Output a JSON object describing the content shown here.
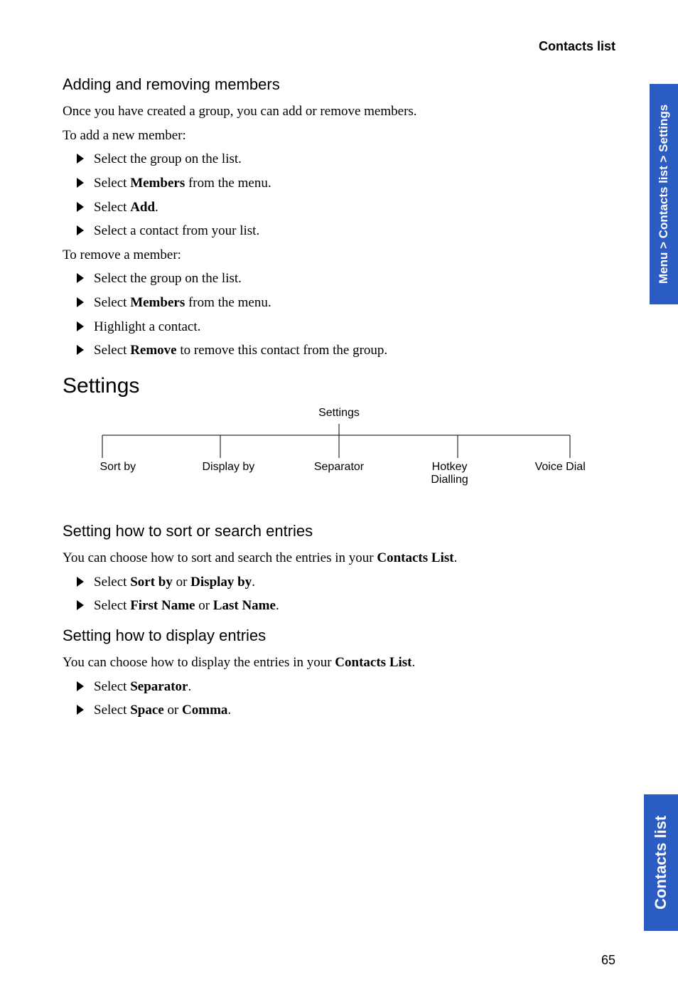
{
  "header": {
    "title": "Contacts list"
  },
  "sections": {
    "adding": {
      "heading": "Adding and removing members",
      "intro": "Once you have created a group, you can add or remove members.",
      "add_intro": "To add a new member:",
      "add_steps": {
        "s1": "Select the group on the list.",
        "s2_pre": "Select ",
        "s2_b": "Members",
        "s2_post": " from the menu.",
        "s3_pre": "Select ",
        "s3_b": "Add",
        "s3_post": ".",
        "s4": "Select a contact from your list."
      },
      "remove_intro": "To remove a member:",
      "remove_steps": {
        "s1": "Select the group on the list.",
        "s2_pre": "Select ",
        "s2_b": "Members",
        "s2_post": " from the menu.",
        "s3": "Highlight a contact.",
        "s4_pre": "Select ",
        "s4_b": "Remove",
        "s4_post": " to remove this contact from the group."
      }
    },
    "settings": {
      "heading": "Settings",
      "root": "Settings",
      "leaves": {
        "l1": "Sort by",
        "l2": "Display by",
        "l3": "Separator",
        "l4a": "Hotkey",
        "l4b": "Dialling",
        "l5": "Voice Dial"
      }
    },
    "sort": {
      "heading": "Setting how to sort or search entries",
      "intro_pre": "You can choose how to sort and search the entries in your ",
      "intro_b": "Contacts List",
      "intro_post": ".",
      "s1_pre": "Select ",
      "s1_b1": "Sort by",
      "s1_mid": " or ",
      "s1_b2": "Display by",
      "s1_post": ".",
      "s2_pre": "Select ",
      "s2_b1": "First Name",
      "s2_mid": " or ",
      "s2_b2": "Last Name",
      "s2_post": "."
    },
    "display": {
      "heading": "Setting how to display entries",
      "intro_pre": "You can choose how to display the entries in your ",
      "intro_b": "Contacts List",
      "intro_post": ".",
      "s1_pre": "Select ",
      "s1_b": "Separator",
      "s1_post": ".",
      "s2_pre": "Select ",
      "s2_b1": "Space",
      "s2_mid": " or ",
      "s2_b2": "Comma",
      "s2_post": "."
    }
  },
  "side_tabs": {
    "top": "Menu > Contacts list > Settings",
    "bottom": "Contacts list"
  },
  "page_number": "65"
}
